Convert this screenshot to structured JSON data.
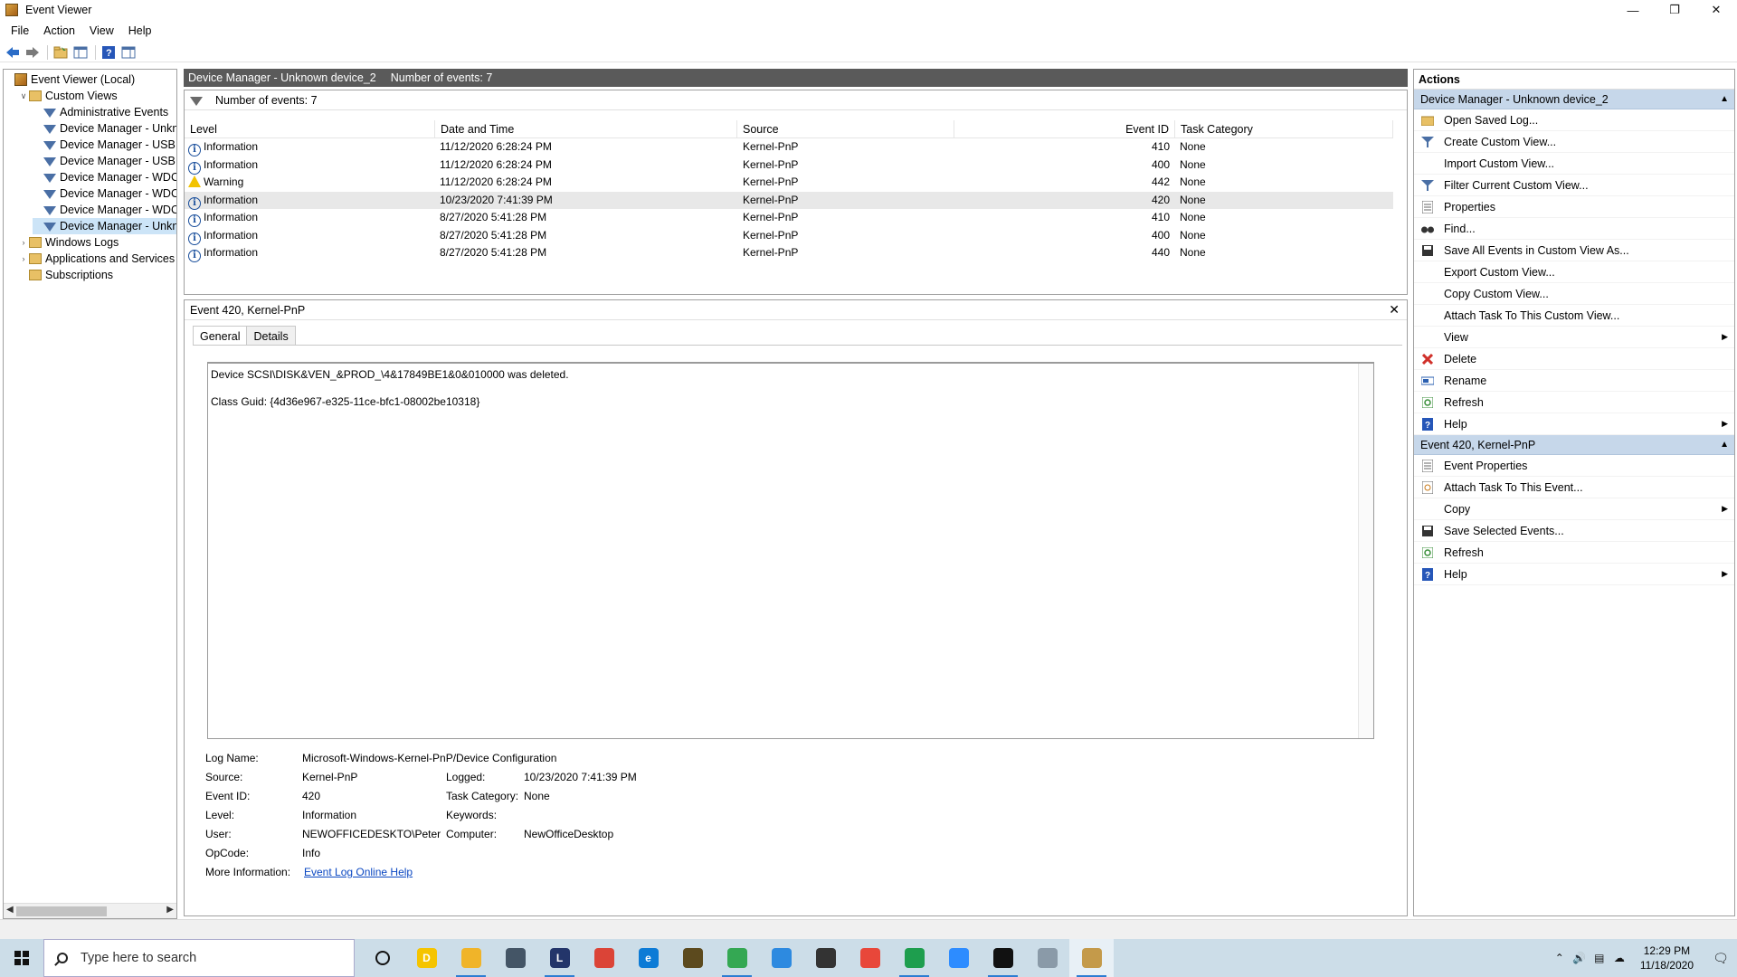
{
  "window": {
    "title": "Event Viewer",
    "controls": {
      "minimize": "—",
      "restore": "❐",
      "close": "✕"
    }
  },
  "menu": [
    "File",
    "Action",
    "View",
    "Help"
  ],
  "toolbar": {
    "icons": [
      "back-arrow-icon",
      "forward-arrow-icon",
      "open-folder-icon",
      "show-tree-icon",
      "help-icon",
      "show-panel-icon"
    ]
  },
  "tree": {
    "items": [
      {
        "label": "Event Viewer (Local)",
        "level": 0,
        "icon": "event-viewer-icon",
        "expander": ""
      },
      {
        "label": "Custom Views",
        "level": 1,
        "icon": "folder-icon",
        "expander": "v"
      },
      {
        "label": "Administrative Events",
        "level": 2,
        "icon": "filter-icon",
        "expander": ""
      },
      {
        "label": "Device Manager - Unkno",
        "level": 2,
        "icon": "filter-icon",
        "expander": ""
      },
      {
        "label": "Device Manager - USB M",
        "level": 2,
        "icon": "filter-icon",
        "expander": ""
      },
      {
        "label": "Device Manager - USB M",
        "level": 2,
        "icon": "filter-icon",
        "expander": ""
      },
      {
        "label": "Device Manager - WDC V",
        "level": 2,
        "icon": "filter-icon",
        "expander": ""
      },
      {
        "label": "Device Manager - WDC V",
        "level": 2,
        "icon": "filter-icon",
        "expander": ""
      },
      {
        "label": "Device Manager - WDC V",
        "level": 2,
        "icon": "filter-icon",
        "expander": ""
      },
      {
        "label": "Device Manager - Unkno",
        "level": 2,
        "icon": "filter-icon",
        "expander": "",
        "selected": true
      },
      {
        "label": "Windows Logs",
        "level": 1,
        "icon": "folder-icon",
        "expander": ">"
      },
      {
        "label": "Applications and Services Lo",
        "level": 1,
        "icon": "folder-icon",
        "expander": ">"
      },
      {
        "label": "Subscriptions",
        "level": 1,
        "icon": "folder-icon",
        "expander": ""
      }
    ]
  },
  "center": {
    "header_title": "Device Manager - Unknown device_2",
    "header_count": "Number of events: 7",
    "filter_text": "Number of events: 7",
    "columns": [
      "Level",
      "Date and Time",
      "Source",
      "Event ID",
      "Task Category"
    ],
    "rows": [
      {
        "level": "Information",
        "kind": "info",
        "date": "11/12/2020 6:28:24 PM",
        "source": "Kernel-PnP",
        "event_id": "410",
        "task": "None"
      },
      {
        "level": "Information",
        "kind": "info",
        "date": "11/12/2020 6:28:24 PM",
        "source": "Kernel-PnP",
        "event_id": "400",
        "task": "None"
      },
      {
        "level": "Warning",
        "kind": "warning",
        "date": "11/12/2020 6:28:24 PM",
        "source": "Kernel-PnP",
        "event_id": "442",
        "task": "None"
      },
      {
        "level": "Information",
        "kind": "info",
        "date": "10/23/2020 7:41:39 PM",
        "source": "Kernel-PnP",
        "event_id": "420",
        "task": "None",
        "selected": true
      },
      {
        "level": "Information",
        "kind": "info",
        "date": "8/27/2020 5:41:28 PM",
        "source": "Kernel-PnP",
        "event_id": "410",
        "task": "None"
      },
      {
        "level": "Information",
        "kind": "info",
        "date": "8/27/2020 5:41:28 PM",
        "source": "Kernel-PnP",
        "event_id": "400",
        "task": "None"
      },
      {
        "level": "Information",
        "kind": "info",
        "date": "8/27/2020 5:41:28 PM",
        "source": "Kernel-PnP",
        "event_id": "440",
        "task": "None"
      }
    ]
  },
  "detail": {
    "title": "Event 420, Kernel-PnP",
    "close": "✕",
    "tabs": [
      "General",
      "Details"
    ],
    "message_lines": [
      "Device SCSI\\DISK&VEN_&PROD_\\4&17849BE1&0&010000 was deleted.",
      "Class Guid: {4d36e967-e325-11ce-bfc1-08002be10318}"
    ],
    "props": {
      "log_name_label": "Log Name:",
      "log_name": "Microsoft-Windows-Kernel-PnP/Device Configuration",
      "source_label": "Source:",
      "source": "Kernel-PnP",
      "logged_label": "Logged:",
      "logged": "10/23/2020 7:41:39 PM",
      "event_id_label": "Event ID:",
      "event_id": "420",
      "task_label": "Task Category:",
      "task": "None",
      "level_label": "Level:",
      "level": "Information",
      "keywords_label": "Keywords:",
      "keywords": "",
      "user_label": "User:",
      "user": "NEWOFFICEDESKTO\\Peter",
      "computer_label": "Computer:",
      "computer": "NewOfficeDesktop",
      "opcode_label": "OpCode:",
      "opcode": "Info",
      "more_info_label": "More Information:",
      "more_info_link": "Event Log Online Help"
    }
  },
  "actions": {
    "title": "Actions",
    "sections": [
      {
        "header": "Device Manager - Unknown device_2",
        "items": [
          {
            "label": "Open Saved Log...",
            "icon": "open-folder-icon",
            "submenu": false
          },
          {
            "label": "Create Custom View...",
            "icon": "filter-icon",
            "submenu": false
          },
          {
            "label": "Import Custom View...",
            "icon": "",
            "submenu": false
          },
          {
            "label": "Filter Current Custom View...",
            "icon": "filter-icon",
            "submenu": false
          },
          {
            "label": "Properties",
            "icon": "properties-icon",
            "submenu": false
          },
          {
            "label": "Find...",
            "icon": "binoculars-icon",
            "submenu": false
          },
          {
            "label": "Save All Events in Custom View As...",
            "icon": "save-icon",
            "submenu": false
          },
          {
            "label": "Export Custom View...",
            "icon": "",
            "submenu": false
          },
          {
            "label": "Copy Custom View...",
            "icon": "",
            "submenu": false
          },
          {
            "label": "Attach Task To This Custom View...",
            "icon": "",
            "submenu": false
          },
          {
            "label": "View",
            "icon": "",
            "submenu": true
          },
          {
            "label": "Delete",
            "icon": "delete-icon",
            "submenu": false
          },
          {
            "label": "Rename",
            "icon": "rename-icon",
            "submenu": false
          },
          {
            "label": "Refresh",
            "icon": "refresh-icon",
            "submenu": false
          },
          {
            "label": "Help",
            "icon": "help-icon",
            "submenu": true
          }
        ]
      },
      {
        "header": "Event 420, Kernel-PnP",
        "items": [
          {
            "label": "Event Properties",
            "icon": "properties-icon",
            "submenu": false
          },
          {
            "label": "Attach Task To This Event...",
            "icon": "task-icon",
            "submenu": false
          },
          {
            "label": "Copy",
            "icon": "",
            "submenu": true
          },
          {
            "label": "Save Selected Events...",
            "icon": "save-icon",
            "submenu": false
          },
          {
            "label": "Refresh",
            "icon": "refresh-icon",
            "submenu": false
          },
          {
            "label": "Help",
            "icon": "help-icon",
            "submenu": true
          }
        ]
      }
    ]
  },
  "taskbar": {
    "search_placeholder": "Type here to search",
    "apps": [
      {
        "name": "cortana-icon",
        "color": "#ffffff",
        "text": "O",
        "open": false
      },
      {
        "name": "app-d-icon",
        "color": "#f5c400",
        "text": "D",
        "open": false
      },
      {
        "name": "file-explorer-icon",
        "color": "#f0b429",
        "text": "",
        "open": true
      },
      {
        "name": "app-jet-icon",
        "color": "#445566",
        "text": "",
        "open": false
      },
      {
        "name": "app-l-icon",
        "color": "#23356a",
        "text": "L",
        "open": true
      },
      {
        "name": "chrome-icon",
        "color": "#db4437",
        "text": "",
        "open": false
      },
      {
        "name": "edge-icon",
        "color": "#0c7bd6",
        "text": "e",
        "open": false
      },
      {
        "name": "app-book-icon",
        "color": "#5c4a1e",
        "text": "",
        "open": false
      },
      {
        "name": "chrome-profile-icon",
        "color": "#34a853",
        "text": "",
        "open": true
      },
      {
        "name": "onedrive-icon",
        "color": "#2d8ae0",
        "text": "",
        "open": false
      },
      {
        "name": "store-icon",
        "color": "#333333",
        "text": "",
        "open": false
      },
      {
        "name": "app-red-icon",
        "color": "#e8473a",
        "text": "",
        "open": false
      },
      {
        "name": "app-green-icon",
        "color": "#1e9e4e",
        "text": "",
        "open": true
      },
      {
        "name": "zoom-icon",
        "color": "#2d8cff",
        "text": "",
        "open": false
      },
      {
        "name": "terminal-icon",
        "color": "#111111",
        "text": "",
        "open": true
      },
      {
        "name": "app-plane-icon",
        "color": "#8a9aa8",
        "text": "",
        "open": false
      },
      {
        "name": "event-viewer-icon",
        "color": "#c49a4a",
        "text": "",
        "open": true,
        "active": true
      }
    ],
    "tray": {
      "time": "12:29 PM",
      "date": "11/18/2020"
    }
  }
}
